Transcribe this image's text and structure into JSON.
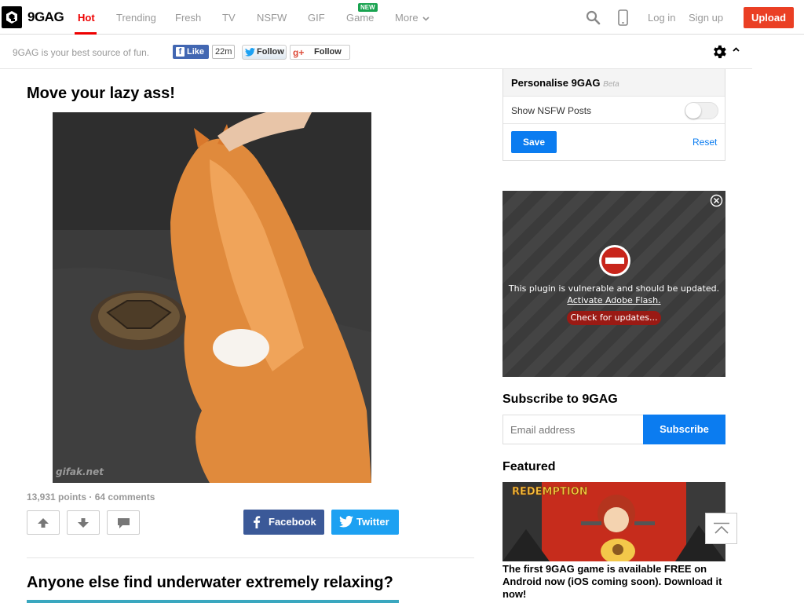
{
  "header": {
    "logo_text": "9GAG",
    "nav": [
      "Hot",
      "Trending",
      "Fresh",
      "TV",
      "NSFW",
      "GIF",
      "Game",
      "More"
    ],
    "new_badge": "NEW",
    "login": "Log in",
    "signup": "Sign up",
    "upload": "Upload"
  },
  "subbar": {
    "tagline": "9GAG is your best source of fun.",
    "fb_like": "Like",
    "fb_count": "22m",
    "tw_follow": "Follow",
    "gp_follow": "Follow"
  },
  "posts": [
    {
      "title": "Move your lazy ass!",
      "watermark": "gifak.net",
      "meta": "13,931 points · 64 comments",
      "share_facebook": "Facebook",
      "share_twitter": "Twitter"
    },
    {
      "title": "Anyone else find underwater extremely relaxing?"
    }
  ],
  "sidebar": {
    "personalise_title": "Personalise 9GAG",
    "personalise_beta": "Beta",
    "nsfw_label": "Show NSFW Posts",
    "nsfw_enabled": false,
    "save": "Save",
    "reset": "Reset",
    "flash_msg": "This plugin is vulnerable and should be updated.",
    "flash_link": "Activate Adobe Flash.",
    "flash_check": "Check for updates...",
    "subscribe_title": "Subscribe to 9GAG",
    "email_placeholder": "Email address",
    "subscribe_btn": "Subscribe",
    "featured_title": "Featured",
    "featured_image_text": "REDEMPTION",
    "featured_caption": "The first 9GAG game is available FREE on Android now (iOS coming soon). Download it now!"
  },
  "colors": {
    "accent_red": "#e00000",
    "upload_red": "#ea3f24",
    "primary_blue": "#0b7cf0",
    "facebook_blue": "#3b5998",
    "twitter_blue": "#1da1f2"
  }
}
